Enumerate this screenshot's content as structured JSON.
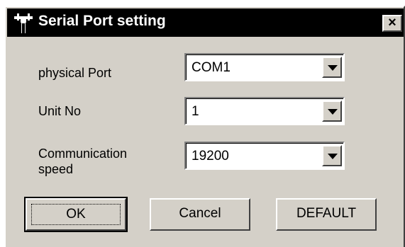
{
  "window": {
    "title": "Serial Port setting",
    "close_label": "×"
  },
  "fields": {
    "physical_port": {
      "label": "physical Port",
      "value": "COM1"
    },
    "unit_no": {
      "label": "Unit No",
      "value": "1"
    },
    "communication_speed": {
      "label_line1": "Communication",
      "label_line2": "speed",
      "value": "19200"
    }
  },
  "buttons": {
    "ok": "OK",
    "cancel": "Cancel",
    "default": "DEFAULT"
  },
  "colors": {
    "face": "#d4d0c8",
    "titlebar": "#000000"
  },
  "icons": {
    "title_icon": "serial-port-plug-icon",
    "close_icon": "close-icon",
    "dropdown_icon": "chevron-down-icon"
  }
}
